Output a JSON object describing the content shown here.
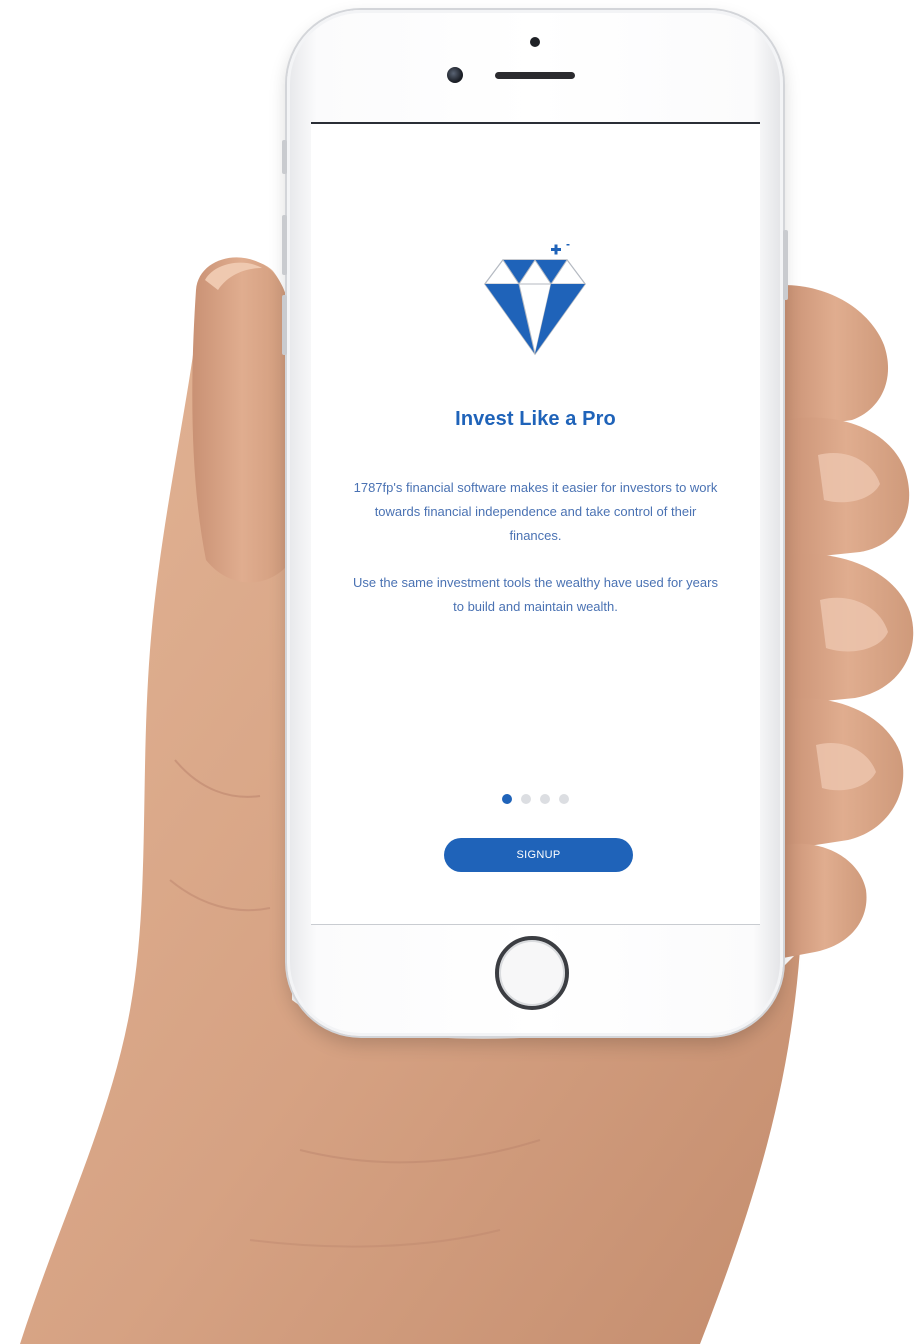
{
  "onboarding": {
    "title": "Invest Like a Pro",
    "paragraph_1": "1787fp's financial software makes it easier for investors to work towards financial independence and take control of their finances.",
    "paragraph_2": "Use the same investment tools the wealthy have used for years to build and maintain wealth.",
    "pager": {
      "total_pages": 4,
      "current_page": 1
    },
    "signup_label": "SIGNUP"
  },
  "icons": {
    "illustration": "diamond-sparkle-icon"
  },
  "colors": {
    "accent": "#1f63b9",
    "text": "#4a72b3",
    "dot_inactive": "#dcdee2",
    "background": "#ffffff",
    "skin": "#d9a98a"
  }
}
